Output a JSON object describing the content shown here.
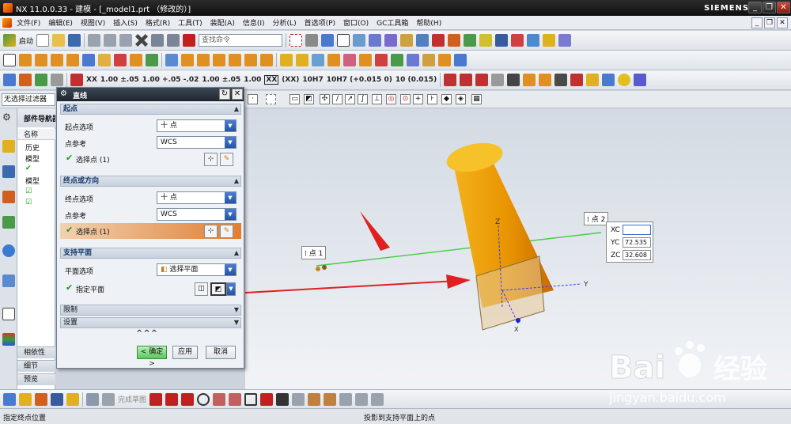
{
  "window": {
    "title": "NX 11.0.0.33 - 建模 - [_model1.prt （修改的）]",
    "brand": "SIEMENS",
    "min": "_",
    "restore": "❐",
    "close": "✕"
  },
  "menubar": {
    "items": [
      "文件(F)",
      "编辑(E)",
      "视图(V)",
      "插入(S)",
      "格式(R)",
      "工具(T)",
      "装配(A)",
      "信息(I)",
      "分析(L)",
      "首选项(P)",
      "窗口(O)",
      "GC工具箱",
      "帮助(H)"
    ],
    "rmin": "_",
    "rrestore": "❐",
    "rclose": "✕"
  },
  "toolbar": {
    "start_label": "启动",
    "search_placeholder": "查找命令",
    "dims": [
      "XX",
      "1.00 ±.05",
      "1.00 +.05 -.02",
      "1.00 ±.05",
      "1.00",
      "XX",
      "(XX)",
      "10H7",
      "10H7 (+0.015 0)",
      "10 (0.015)"
    ]
  },
  "selection": {
    "filter": "无选择过滤器"
  },
  "nav": {
    "title": "部件导航器",
    "column": "名称",
    "rows": [
      "历史",
      "模型",
      "",
      "模型"
    ],
    "tabs": [
      "相依性",
      "细节",
      "预览"
    ]
  },
  "dialog": {
    "title": "直线",
    "start": {
      "section": "起点",
      "option_label": "起点选项",
      "option_value": "十 点",
      "ref_label": "点参考",
      "ref_value": "WCS",
      "select_label": "选择点 (1)"
    },
    "end": {
      "section": "终点或方向",
      "option_label": "终点选项",
      "option_value": "十 点",
      "ref_label": "点参考",
      "ref_value": "WCS",
      "select_label": "选择点 (1)"
    },
    "support": {
      "section": "支持平面",
      "option_label": "平面选项",
      "option_value": "选择平面",
      "select_label": "指定平面"
    },
    "limits": "限制",
    "settings": "设置",
    "collapse": "^^^",
    "ok": "< 确定 >",
    "apply": "应用",
    "cancel": "取消"
  },
  "viewport": {
    "point1": "点 1",
    "point2": "点 2",
    "xc_label": "XC",
    "yc_label": "YC",
    "zc_label": "ZC",
    "xc": "",
    "yc": "72.535",
    "zc": "32.608",
    "axis_y": "Y",
    "axis_z": "Z",
    "axis_x": "X"
  },
  "bottom": {
    "sketch_label": "完成草图"
  },
  "status": {
    "left": "指定终点位置",
    "middle": "投影到支持平面上的点"
  },
  "watermark": {
    "brand": "Bai",
    "sub": "经验",
    "url": "jingyan.baidu.com"
  },
  "colors": {
    "cylinder": "#f0a000",
    "arrow": "#e02020",
    "line": "#44cc44",
    "highlight": "#e07f33"
  }
}
